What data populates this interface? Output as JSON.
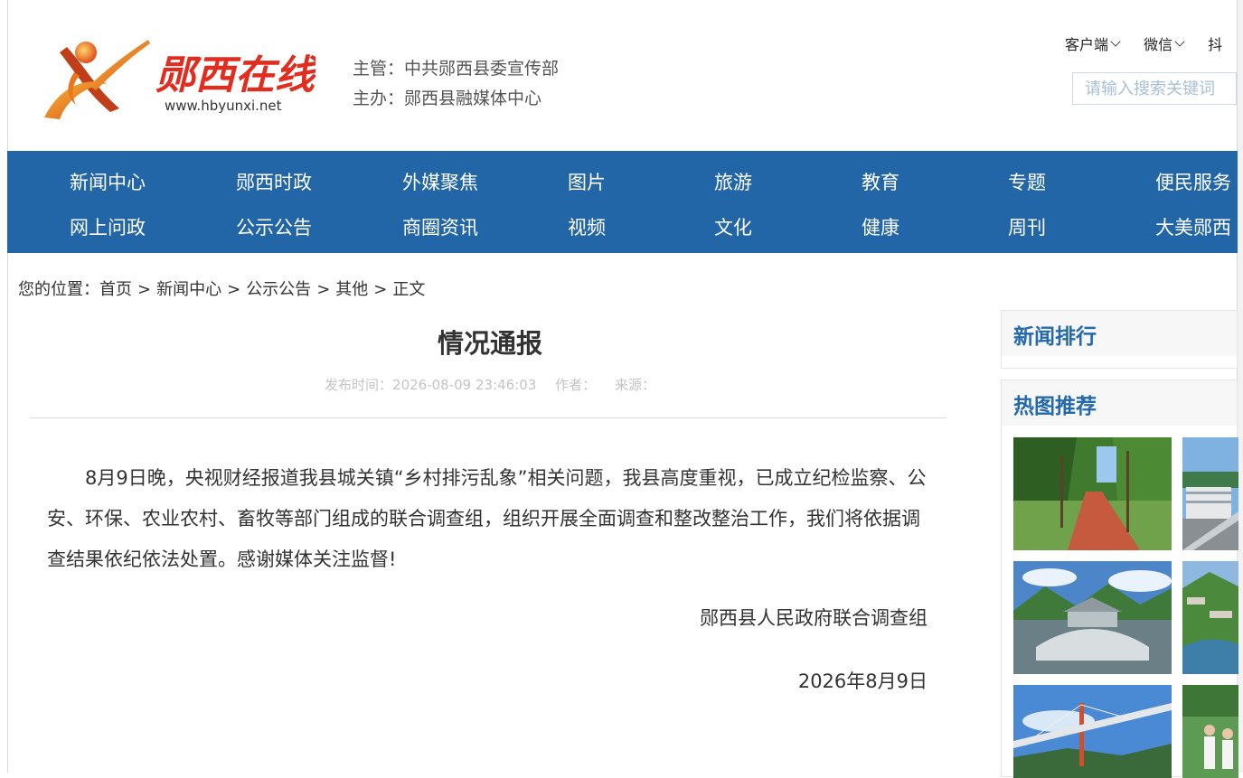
{
  "header": {
    "site_name": "郧西在线",
    "site_url": "www.hbyunxi.net",
    "sponsor_line1": "主管：中共郧西县委宣传部",
    "sponsor_line2": "主办：郧西县融媒体中心",
    "top_links": [
      "客户端",
      "微信",
      "抖"
    ],
    "search_placeholder": "请输入搜索关键词"
  },
  "nav": {
    "row1": [
      "新闻中心",
      "郧西时政",
      "外媒聚焦",
      "图片",
      "旅游",
      "教育",
      "专题",
      "便民服务"
    ],
    "row2": [
      "网上问政",
      "公示公告",
      "商圈资讯",
      "视频",
      "文化",
      "健康",
      "周刊",
      "大美郧西"
    ]
  },
  "breadcrumb": {
    "label": "您的位置：",
    "items": [
      "首页",
      "新闻中心",
      "公示公告",
      "其他",
      "正文"
    ],
    "separator": ">"
  },
  "article": {
    "title": "情况通报",
    "publish_time": "发布时间：2026-08-09 23:46:03",
    "author": "作者：",
    "source": "来源：",
    "body": "8月9日晚，央视财经报道我县城关镇“乡村排污乱象”相关问题，我县高度重视，已成立纪检监察、公安、环保、农业农村、畜牧等部门组成的联合调查组，组织开展全面调查和整改整治工作，我们将依据调查结果依纪依法处置。感谢媒体关注监督!",
    "signature": "郧西县人民政府联合调查组",
    "date": "2026年8月9日"
  },
  "sidebar": {
    "news_rank_title": "新闻排行",
    "hot_pics_title": "热图推荐"
  },
  "colors": {
    "nav_bg": "#2266a8",
    "side_title": "#2469ad",
    "logo_red": "#e32b1e"
  }
}
